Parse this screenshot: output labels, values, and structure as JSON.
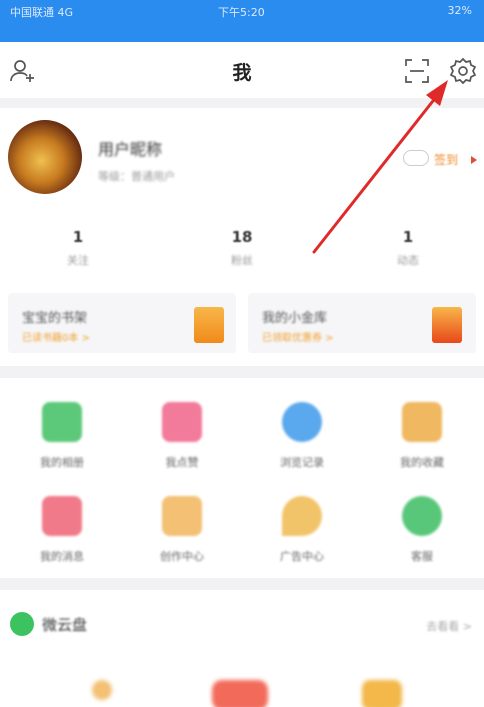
{
  "statusbar": {
    "carrier": "中国联通 4G",
    "time": "下午5:20",
    "battery": "32%"
  },
  "header": {
    "title": "我",
    "icons": {
      "add_friend": "add-user-icon",
      "scan": "scan-icon",
      "settings": "gear-icon"
    }
  },
  "profile": {
    "username": "用户昵称",
    "level": "等级：普通用户",
    "checkin_label": "签到"
  },
  "stats": [
    {
      "num": "1",
      "label": "关注"
    },
    {
      "num": "18",
      "label": "粉丝"
    },
    {
      "num": "1",
      "label": "动态"
    }
  ],
  "banners": [
    {
      "title": "宝宝的书架",
      "subtitle": "已读书籍0本 >"
    },
    {
      "title": "我的小金库",
      "subtitle": "已领取优惠券 >"
    }
  ],
  "grid_items": [
    {
      "label": "我的相册",
      "color": "#5cc87a"
    },
    {
      "label": "我点赞",
      "color": "#f27a9a"
    },
    {
      "label": "浏览记录",
      "color": "#5aa8ee"
    },
    {
      "label": "我的收藏",
      "color": "#f0b860"
    },
    {
      "label": "我的消息",
      "color": "#f07a8a"
    },
    {
      "label": "创作中心",
      "color": "#f3c074"
    },
    {
      "label": "广告中心",
      "color": "#f2c46a"
    },
    {
      "label": "客服",
      "color": "#59c77a"
    }
  ],
  "section": {
    "title": "微云盘",
    "more": "去看看 >"
  },
  "colors": {
    "accent": "#2b8cf0",
    "arrow": "#e02a2a",
    "checkin": "#f08a2a"
  }
}
